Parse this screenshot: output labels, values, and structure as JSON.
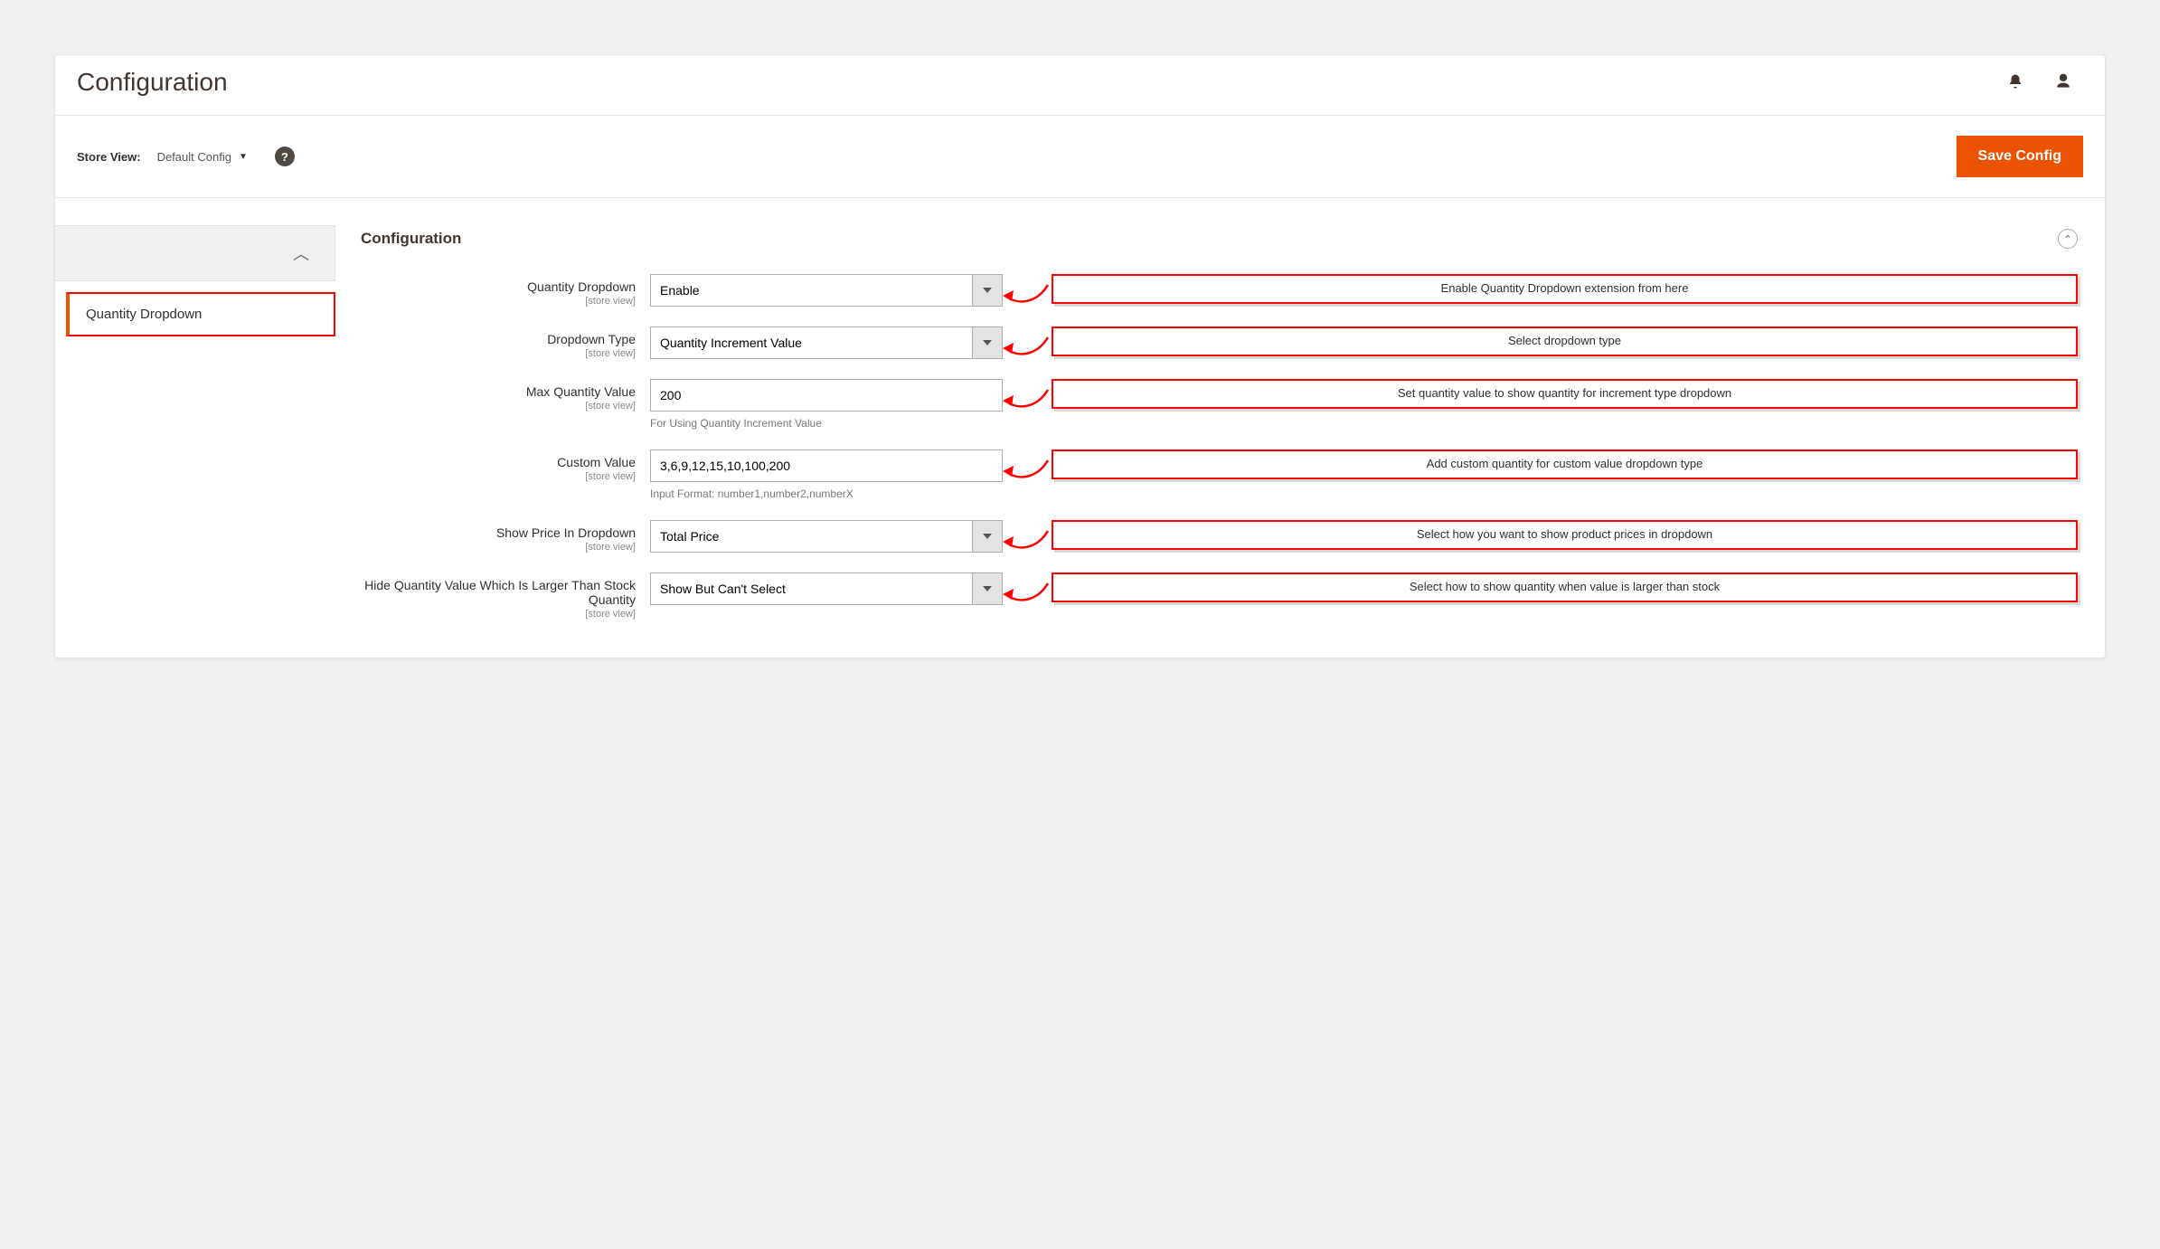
{
  "header": {
    "title": "Configuration"
  },
  "toolbar": {
    "store_view_label": "Store View:",
    "store_view_value": "Default Config",
    "save_label": "Save Config"
  },
  "sidebar": {
    "active_item": "Quantity Dropdown"
  },
  "section": {
    "title": "Configuration"
  },
  "fields": [
    {
      "label": "Quantity Dropdown",
      "scope": "[store view]",
      "type": "select",
      "value": "Enable",
      "note": "",
      "annotation": "Enable Quantity Dropdown extension from here"
    },
    {
      "label": "Dropdown Type",
      "scope": "[store view]",
      "type": "select",
      "value": "Quantity Increment Value",
      "note": "",
      "annotation": "Select dropdown type"
    },
    {
      "label": "Max Quantity Value",
      "scope": "[store view]",
      "type": "text",
      "value": "200",
      "note": "For Using Quantity Increment Value",
      "annotation": "Set quantity value to show quantity for increment type dropdown"
    },
    {
      "label": "Custom Value",
      "scope": "[store view]",
      "type": "text",
      "value": "3,6,9,12,15,10,100,200",
      "note": "Input Format: number1,number2,numberX",
      "annotation": "Add custom quantity for custom value dropdown type"
    },
    {
      "label": "Show Price In Dropdown",
      "scope": "[store view]",
      "type": "select",
      "value": "Total Price",
      "note": "",
      "annotation": "Select how you want to show product prices in dropdown"
    },
    {
      "label": "Hide Quantity Value Which Is Larger Than Stock Quantity",
      "scope": "[store view]",
      "type": "select",
      "value": "Show But Can't Select",
      "note": "",
      "annotation": "Select how to show quantity when value is larger than stock"
    }
  ]
}
